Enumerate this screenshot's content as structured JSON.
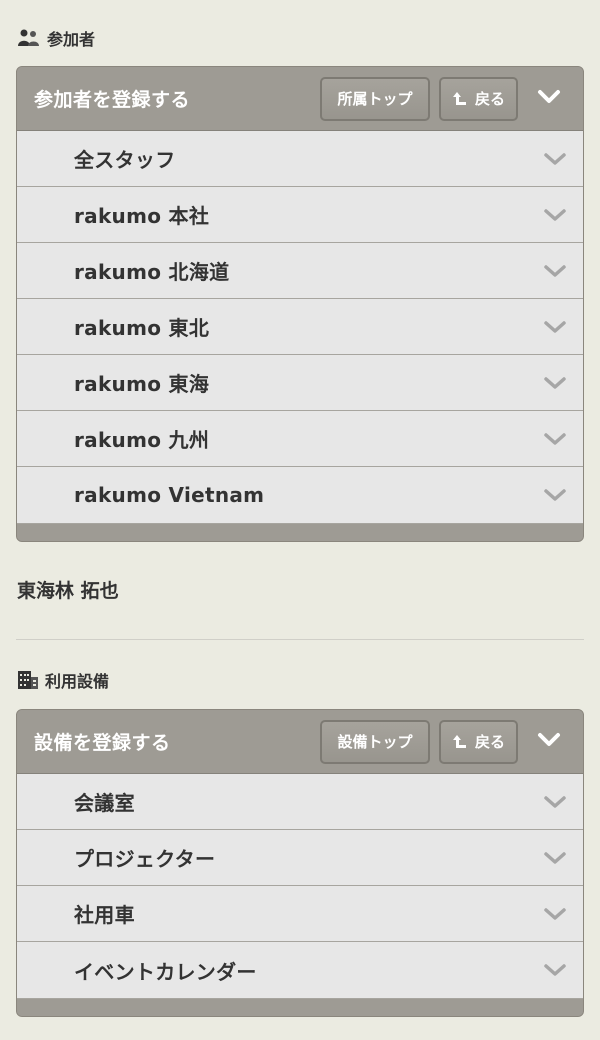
{
  "participants": {
    "heading": "参加者",
    "panel": {
      "title": "参加者を登録する",
      "top_button": "所属トップ",
      "back_button": "戻る",
      "items": [
        {
          "label": "全スタッフ"
        },
        {
          "label": "rakumo 本社"
        },
        {
          "label": "rakumo 北海道"
        },
        {
          "label": "rakumo 東北"
        },
        {
          "label": "rakumo 東海"
        },
        {
          "label": "rakumo 九州"
        },
        {
          "label": "rakumo Vietnam"
        }
      ]
    },
    "selected_user": "東海林 拓也"
  },
  "facilities": {
    "heading": "利用設備",
    "panel": {
      "title": "設備を登録する",
      "top_button": "設備トップ",
      "back_button": "戻る",
      "items": [
        {
          "label": "会議室"
        },
        {
          "label": "プロジェクター"
        },
        {
          "label": "社用車"
        },
        {
          "label": "イベントカレンダー"
        }
      ]
    }
  },
  "icons": {
    "participants": "people-icon",
    "facilities": "building-icon",
    "back": "return-arrow-icon",
    "collapse": "chevron-down-icon",
    "expand_item": "chevron-down-icon"
  },
  "colors": {
    "background": "#ebebe1",
    "panel_header": "#9e9b94",
    "list_item": "#e7e7e7",
    "text": "#333333",
    "chevron": "#a6a6a6"
  }
}
